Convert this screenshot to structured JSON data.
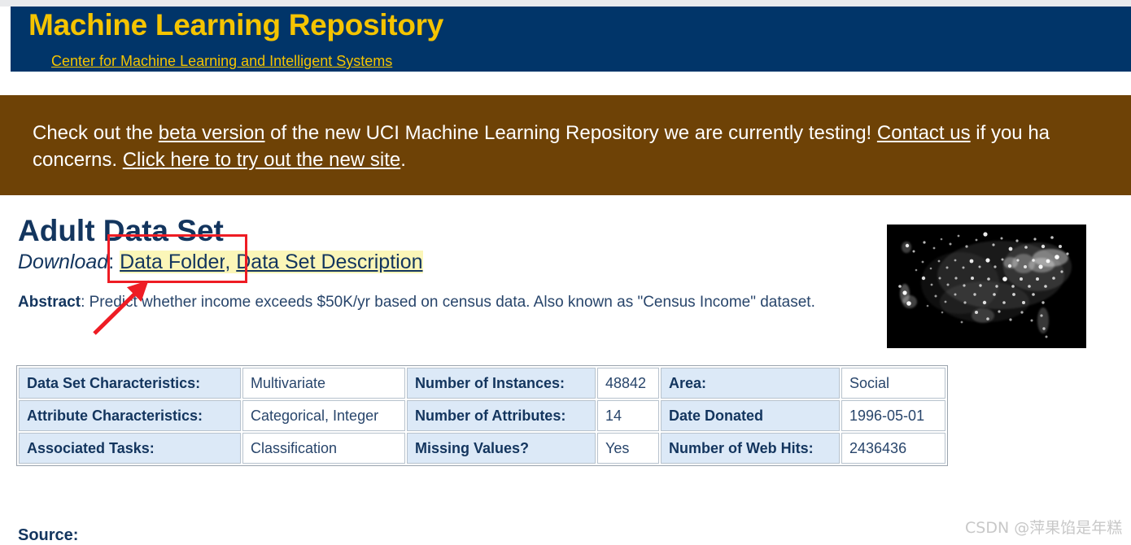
{
  "header": {
    "title": "Machine Learning Repository",
    "subtitle_link": "Center for Machine Learning and Intelligent Systems"
  },
  "beta_banner": {
    "text_1": "Check out the ",
    "link_beta": "beta version",
    "text_2": " of the new UCI Machine Learning Repository we are currently testing! ",
    "link_contact": "Contact us",
    "text_3": " if you ha",
    "text_4": "concerns. ",
    "link_try": "Click here to try out the new site",
    "text_5": "."
  },
  "page": {
    "dataset_title": "Adult Data Set",
    "download_label": "Download",
    "download_colon": ": ",
    "link_data_folder": "Data Folder",
    "link_separator": ", ",
    "link_data_set_description": "Data Set Description",
    "abstract_label": "Abstract",
    "abstract_text": ": Predict whether income exceeds $50K/yr based on census data. Also known as \"Census Income\" dataset.",
    "source_heading": "Source:"
  },
  "image": {
    "alt_name": "usa-night-lights-image"
  },
  "info_table": {
    "rows": [
      {
        "k1": "Data Set Characteristics:",
        "v1": "Multivariate",
        "k2": "Number of Instances:",
        "v2": "48842",
        "k3": "Area:",
        "v3": "Social"
      },
      {
        "k1": "Attribute Characteristics:",
        "v1": "Categorical, Integer",
        "k2": "Number of Attributes:",
        "v2": "14",
        "k3": "Date Donated",
        "v3": "1996-05-01"
      },
      {
        "k1": "Associated Tasks:",
        "v1": "Classification",
        "k2": "Missing Values?",
        "v2": "Yes",
        "k3": "Number of Web Hits:",
        "v3": "2436436"
      }
    ]
  },
  "watermark": {
    "text": "CSDN @萍果馅是年糕"
  },
  "colors": {
    "header_navy": "#013569",
    "header_yellow": "#f5c400",
    "banner_brown": "#6e4206",
    "text_navy": "#13355e",
    "highlight_yellow": "#fbf6b8",
    "table_header_blue": "#dce9f7",
    "annotation_red": "#ee1c24"
  }
}
